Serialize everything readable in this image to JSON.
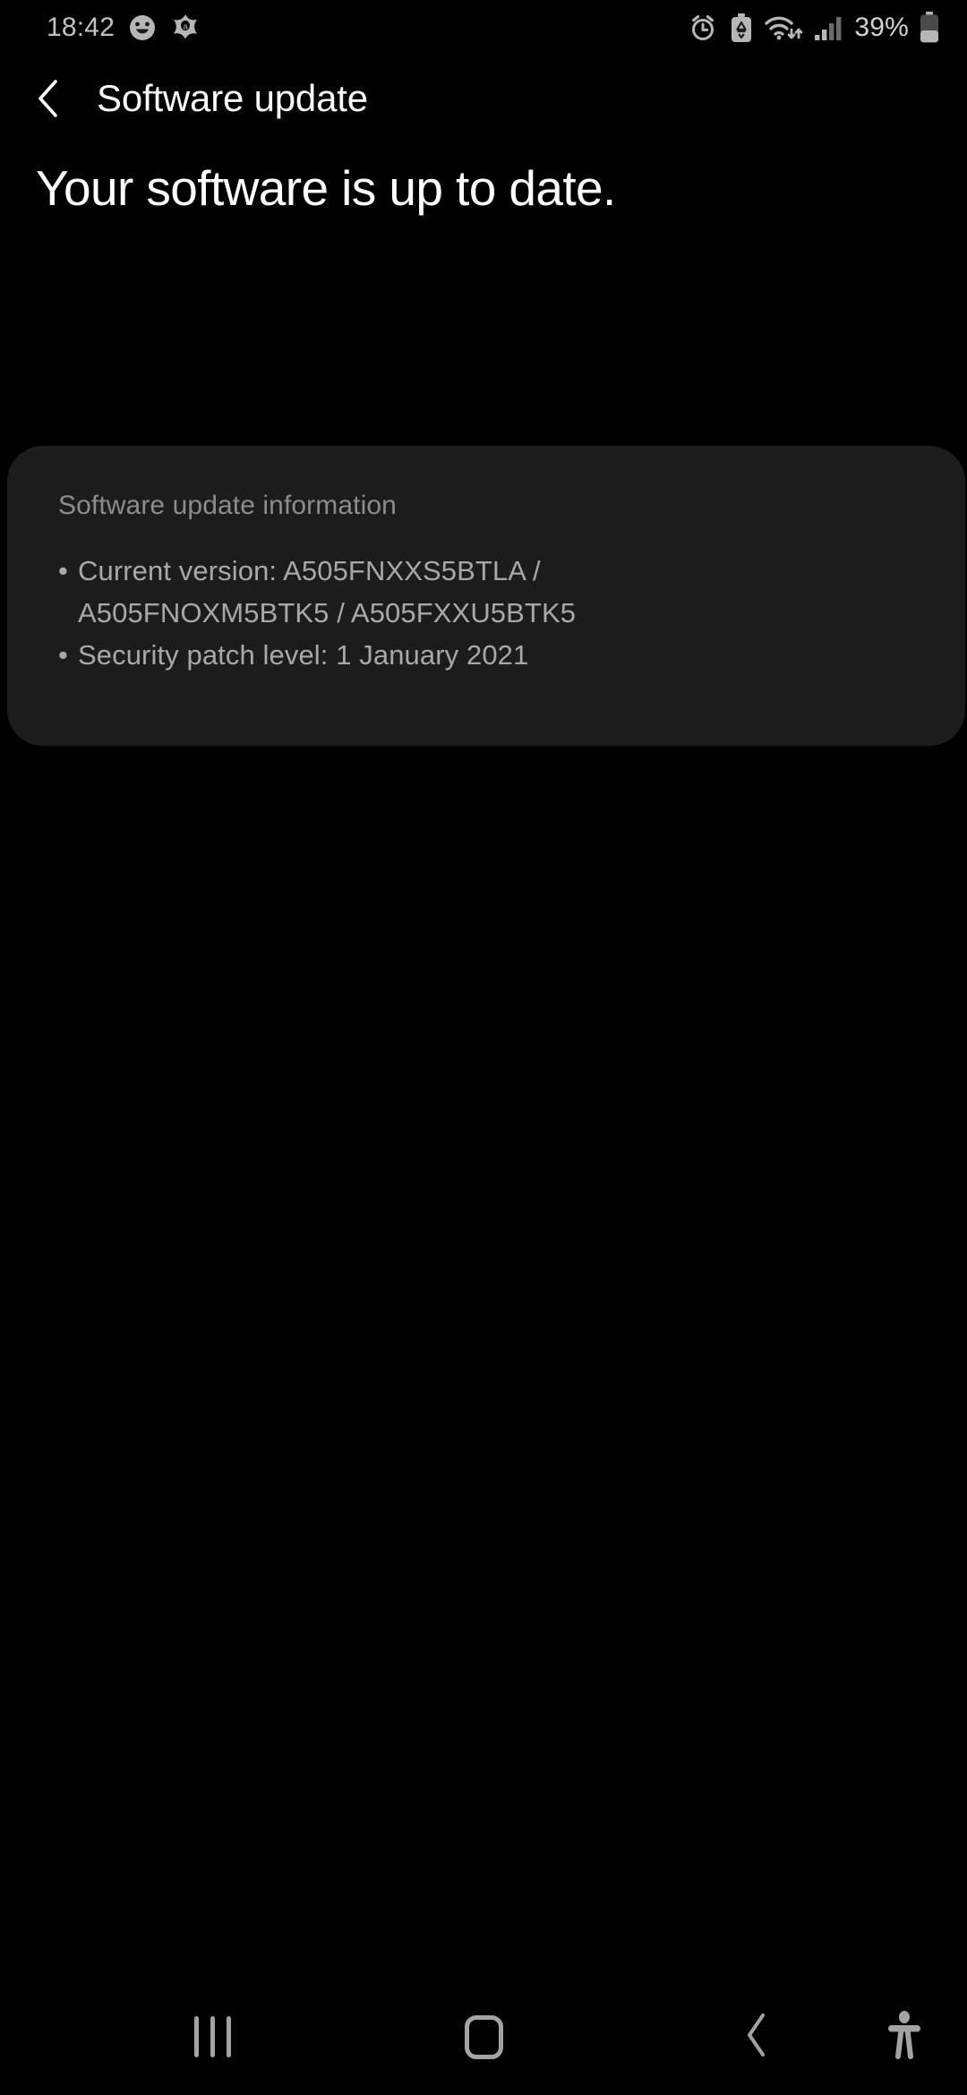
{
  "status_bar": {
    "clock": "18:42",
    "battery_percent": "39%",
    "left_icons": [
      "smiley-face-icon",
      "avast-icon"
    ],
    "right_icons": [
      "alarm-icon",
      "battery-saver-icon",
      "wifi-icon",
      "signal-bars-icon",
      "battery-icon"
    ],
    "colors": {
      "icon": "#b6b6b6",
      "text": "#c8c8c8"
    }
  },
  "app_bar": {
    "back_label": "back-chevron",
    "title": "Software update"
  },
  "main": {
    "headline": "Your software is up to date.",
    "card": {
      "title": "Software update information",
      "items": [
        {
          "bullet": "•",
          "line1": "Current version: A505FNXXS5BTLA /",
          "line2": "A505FNOXM5BTK5 / A505FXXU5BTK5"
        },
        {
          "bullet": "•",
          "line1": "Security patch level: 1 January 2021",
          "line2": ""
        }
      ],
      "background": "#1c1c1c",
      "title_color": "#8c8c8c",
      "text_color": "#a8a8a8"
    }
  },
  "nav_bar": {
    "recents_label": "recents-button",
    "home_label": "home-button",
    "back_label": "back-button",
    "accessibility_label": "accessibility-button",
    "icon_color": "#a3a3a3"
  }
}
